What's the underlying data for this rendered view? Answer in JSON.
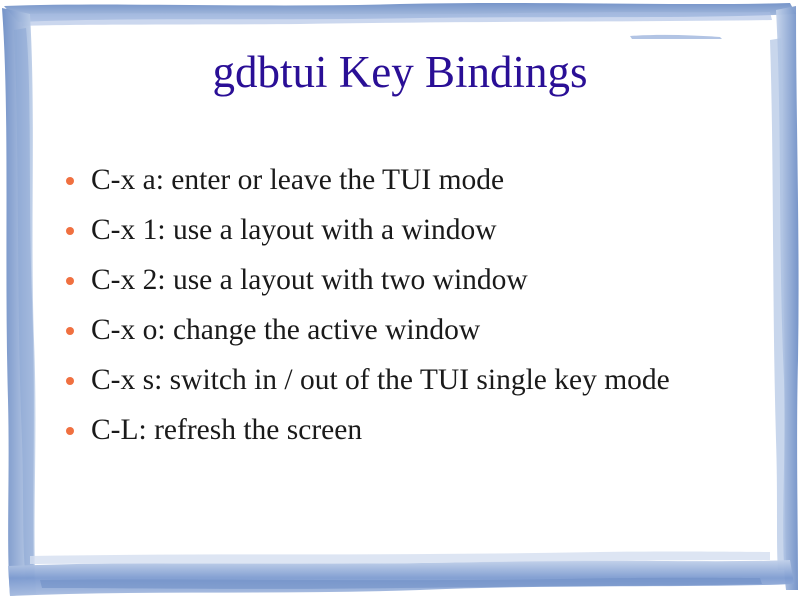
{
  "slide": {
    "title": "gdbtui Key Bindings",
    "bullets": [
      "C-x a: enter or leave the TUI mode",
      "C-x 1: use a layout with a window",
      "C-x 2: use a layout with two window",
      "C-x o: change the active window",
      "C-x s: switch in / out of the TUI single key mode",
      "C-L: refresh the screen"
    ]
  },
  "colors": {
    "title": "#2a0f96",
    "bullet": "#f07040",
    "frame": "#7f9ccc",
    "frame_light": "#b6c8e4",
    "text": "#1a1a1a"
  }
}
